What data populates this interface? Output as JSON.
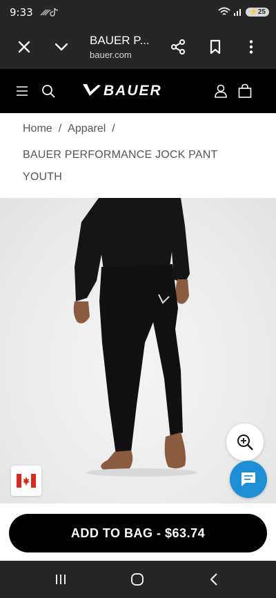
{
  "status_bar": {
    "time": "9:33",
    "battery": "25"
  },
  "browser": {
    "title": "BAUER P...",
    "url": "bauer.com"
  },
  "site": {
    "brand": "BAUER"
  },
  "breadcrumb": {
    "home": "Home",
    "apparel": "Apparel",
    "separator": "/"
  },
  "product": {
    "title": "BAUER PERFORMANCE JOCK PANT YOUTH",
    "add_to_bag": "ADD TO BAG - $63.74"
  },
  "colors": {
    "chat_button": "#1e8fd6",
    "header_bg": "#000000",
    "system_bar": "#262626"
  },
  "icons": [
    "close-icon",
    "chevron-down-icon",
    "share-icon",
    "bookmark-icon",
    "more-vert-icon",
    "menu-icon",
    "search-icon",
    "account-icon",
    "shopping-bag-icon",
    "zoom-in-icon",
    "chat-icon",
    "canada-flag-icon",
    "recents-icon",
    "home-icon",
    "back-icon"
  ]
}
